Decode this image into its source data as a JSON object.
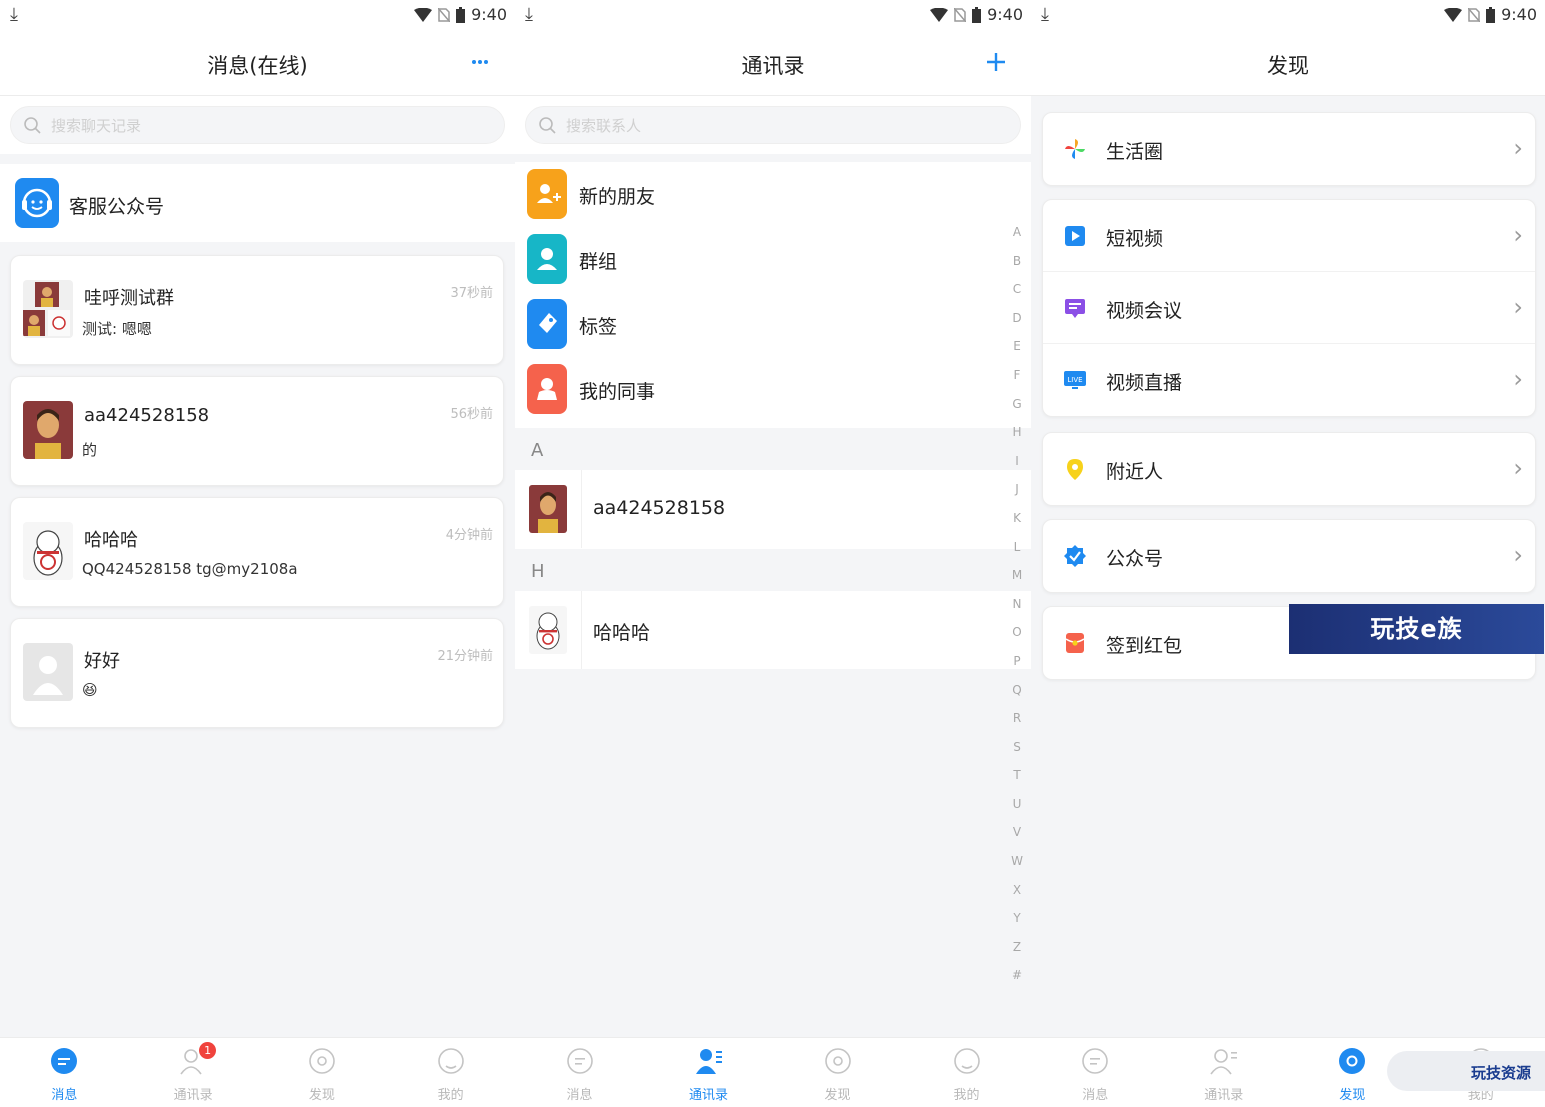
{
  "status": {
    "time": "9:40"
  },
  "screen1": {
    "title": "消息(在线)",
    "search_placeholder": "搜索聊天记录",
    "official_account": "客服公众号",
    "chats": [
      {
        "name": "哇呼测试群",
        "preview": "测试: 嗯嗯",
        "time": "37秒前"
      },
      {
        "name": "aa424528158",
        "preview": "的",
        "time": "56秒前"
      },
      {
        "name": "哈哈哈",
        "preview": "QQ424528158 tg@my2108a",
        "time": "4分钟前"
      },
      {
        "name": "好好",
        "preview": "😆",
        "time": "21分钟前"
      }
    ]
  },
  "screen2": {
    "title": "通讯录",
    "search_placeholder": "搜索联系人",
    "menu": [
      {
        "label": "新的朋友",
        "color": "#f7a21b"
      },
      {
        "label": "群组",
        "color": "#17b6c7"
      },
      {
        "label": "标签",
        "color": "#1f8af0"
      },
      {
        "label": "我的同事",
        "color": "#f5624c"
      }
    ],
    "sections": [
      {
        "letter": "A",
        "contact": "aa424528158"
      },
      {
        "letter": "H",
        "contact": "哈哈哈"
      }
    ],
    "alphabet": [
      "A",
      "B",
      "C",
      "D",
      "E",
      "F",
      "G",
      "H",
      "I",
      "J",
      "K",
      "L",
      "M",
      "N",
      "O",
      "P",
      "Q",
      "R",
      "S",
      "T",
      "U",
      "V",
      "W",
      "X",
      "Y",
      "Z",
      "#"
    ]
  },
  "screen3": {
    "title": "发现",
    "items": {
      "moments": "生活圈",
      "short_video": "短视频",
      "video_meeting": "视频会议",
      "live": "视频直播",
      "nearby": "附近人",
      "official": "公众号",
      "signin": "签到红包"
    }
  },
  "tabs": {
    "messages": "消息",
    "contacts": "通讯录",
    "discover": "发现",
    "me": "我的",
    "contacts_badge": "1"
  },
  "watermark": {
    "banner": "玩技e族",
    "corner": "玩技资源"
  },
  "colors": {
    "accent": "#1f8af0",
    "badge": "#f0433d"
  },
  "chevron": "›"
}
